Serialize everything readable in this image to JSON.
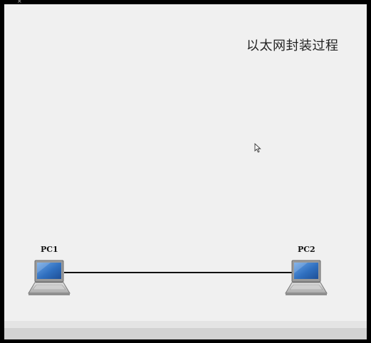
{
  "diagram": {
    "title": "以太网封装过程",
    "nodes": [
      {
        "id": "pc1",
        "label": "PC1",
        "type": "laptop"
      },
      {
        "id": "pc2",
        "label": "PC2",
        "type": "laptop"
      }
    ],
    "links": [
      {
        "from": "PC1",
        "to": "PC2"
      }
    ]
  },
  "icons": {
    "cursor": "mouse-pointer-icon",
    "pc": "laptop-icon"
  },
  "colors": {
    "background": "#f0f0f0",
    "frame": "#000000",
    "screen": "#3b78c4",
    "link": "#111111"
  }
}
